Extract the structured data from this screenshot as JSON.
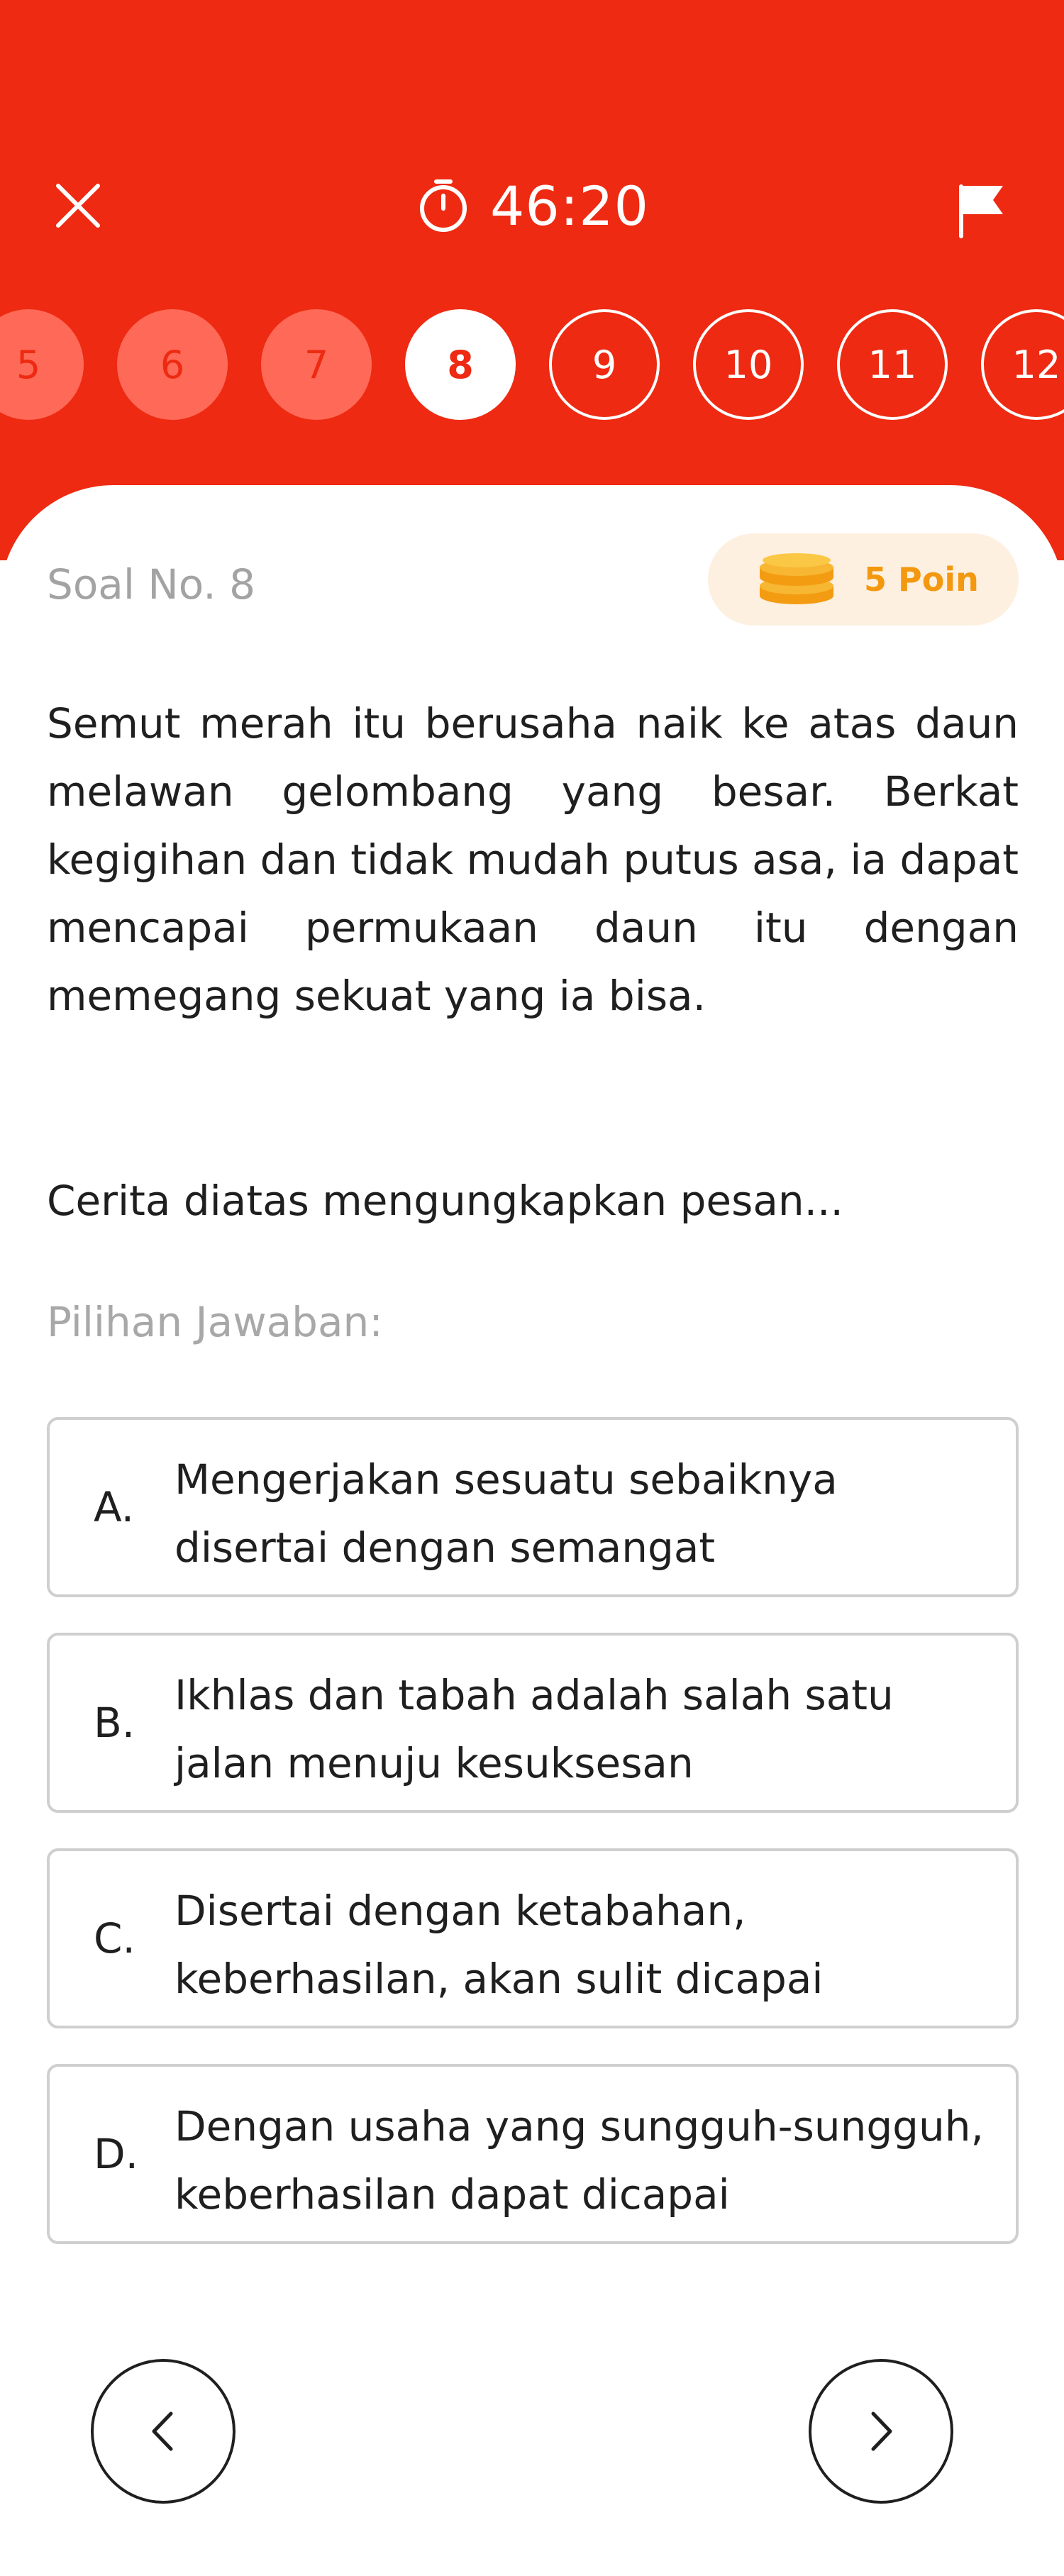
{
  "header": {
    "timer": "46:20",
    "colors": {
      "brand": "#ee2a12",
      "done_circle": "#ff6a58",
      "poin": "#f3980f"
    },
    "close_icon": "close-icon",
    "flag_icon": "flag-icon",
    "stopwatch_icon": "stopwatch-icon"
  },
  "question_nav": [
    {
      "label": "5",
      "state": "done"
    },
    {
      "label": "6",
      "state": "done"
    },
    {
      "label": "7",
      "state": "done"
    },
    {
      "label": "8",
      "state": "current"
    },
    {
      "label": "9",
      "state": "todo"
    },
    {
      "label": "10",
      "state": "todo"
    },
    {
      "label": "11",
      "state": "todo"
    },
    {
      "label": "12",
      "state": "todo"
    }
  ],
  "question": {
    "number_label": "Soal No. 8",
    "points_label": "5 Poin",
    "paragraph": "Semut merah itu berusaha naik ke atas daun melawan gelombang yang besar. Berkat kegigihan dan tidak mudah putus asa, ia dapat mencapai permukaan daun itu dengan memegang sekuat yang ia bisa.",
    "prompt": "Cerita diatas mengungkapkan pesan...",
    "choices_label": "Pilihan Jawaban:",
    "options": [
      {
        "letter": "A.",
        "text": "Mengerjakan sesuatu sebaiknya disertai dengan semangat"
      },
      {
        "letter": "B.",
        "text": "Ikhlas dan tabah adalah salah satu jalan menuju kesuksesan"
      },
      {
        "letter": "C.",
        "text": "Disertai dengan ketabahan, keberhasilan, akan sulit dicapai"
      },
      {
        "letter": "D.",
        "text": "Dengan usaha yang sungguh-sungguh, keberhasilan dapat dicapai"
      }
    ]
  },
  "footer": {
    "prev_icon": "chevron-left-icon",
    "next_icon": "chevron-right-icon"
  }
}
